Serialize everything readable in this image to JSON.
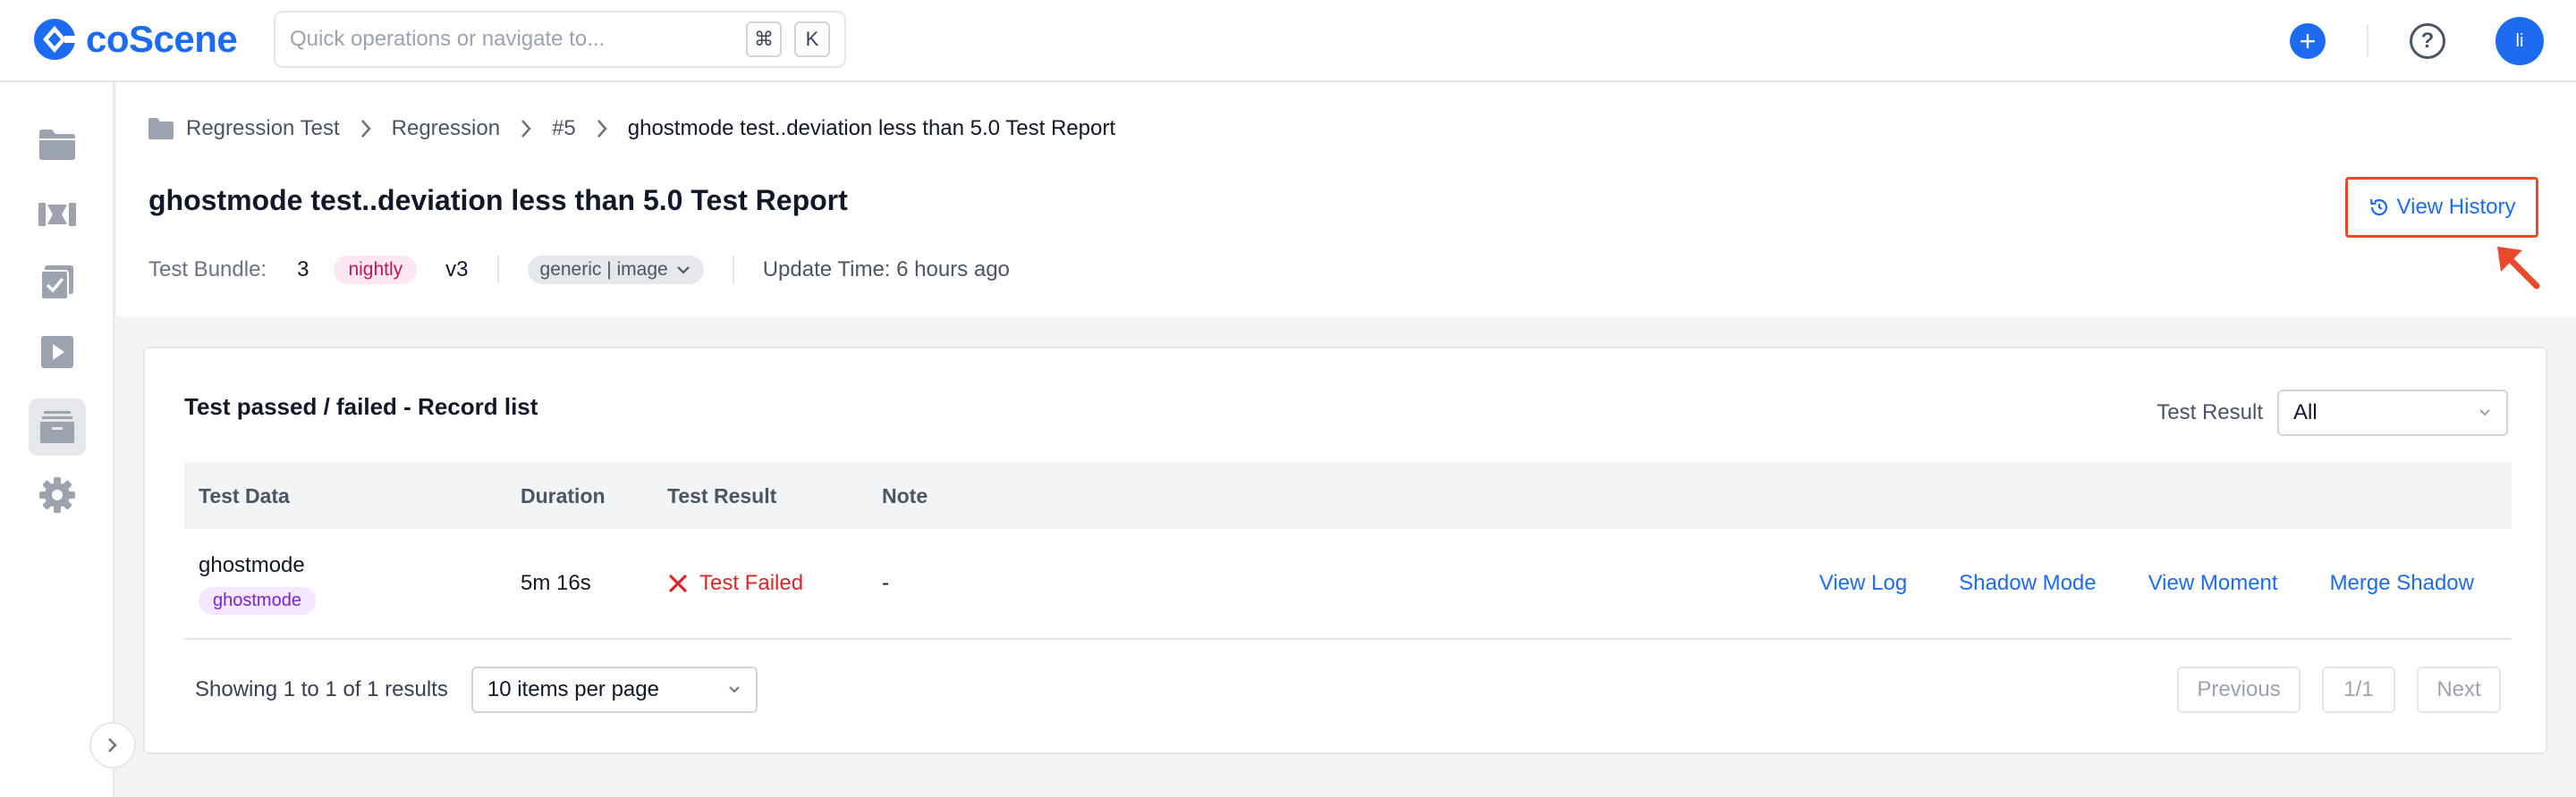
{
  "app": {
    "logo_text": "coScene",
    "brand_color": "#1d6bf0"
  },
  "search": {
    "placeholder": "Quick operations or navigate to...",
    "kbd_cmd": "⌘",
    "kbd_key": "K"
  },
  "topbar": {
    "avatar_text": "li",
    "plus_label": "+",
    "help_label": "?"
  },
  "sidebar": {
    "items": [
      "folder-icon",
      "video-icon",
      "checklist-icon",
      "play-icon",
      "archive-icon",
      "gear-icon"
    ],
    "active_index": 4
  },
  "breadcrumb": [
    "Regression Test",
    "Regression",
    "#5",
    "ghostmode test..deviation less than 5.0 Test Report"
  ],
  "page": {
    "title": "ghostmode test..deviation less than 5.0 Test Report",
    "view_history": "View History",
    "highlight_color": "#ea4a2b"
  },
  "meta": {
    "bundle_label": "Test Bundle:",
    "bundle_value": "3",
    "tag": "nightly",
    "version": "v3",
    "type_tag": "generic | image",
    "update_time": "Update Time: 6 hours ago"
  },
  "card": {
    "title": "Test passed / failed - Record list",
    "filter_label": "Test Result",
    "filter_value": "All"
  },
  "table": {
    "headers": [
      "Test Data",
      "Duration",
      "Test Result",
      "Note"
    ],
    "rows": [
      {
        "name": "ghostmode",
        "tag": "ghostmode",
        "duration": "5m 16s",
        "result": "Test Failed",
        "note": "-",
        "actions": [
          "View Log",
          "Shadow Mode",
          "View Moment",
          "Merge Shadow"
        ]
      }
    ]
  },
  "pagination": {
    "summary": "Showing 1 to 1 of 1 results",
    "per_page": "10 items per page",
    "previous": "Previous",
    "page": "1/1",
    "next": "Next"
  }
}
